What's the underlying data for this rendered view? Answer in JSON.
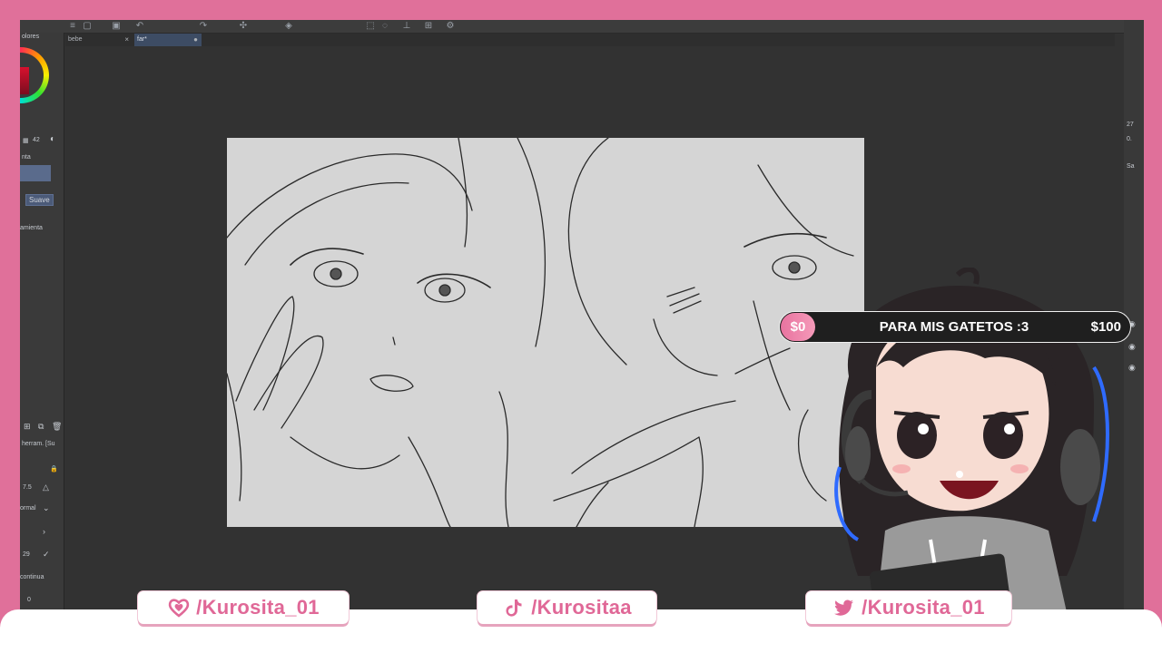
{
  "app": {
    "tabs": [
      {
        "label": "bebe",
        "close": "×"
      },
      {
        "label": "far*",
        "close": "●"
      }
    ],
    "left_panel": {
      "color_header": "olores",
      "size_value": "42",
      "tool_header": "nta",
      "soft_button": "Suave",
      "tool_label": "amienta",
      "layer_label": "herram. [Su",
      "opacity_value": "7.5",
      "blend_mode": "ormal",
      "value_29": "29",
      "continue_label": "continua",
      "zero_value": "0"
    },
    "right_panel": {
      "value_a": "27",
      "value_b": "0.",
      "label_sa": "Sa"
    }
  },
  "goal": {
    "start": "$0",
    "title": "PARA MIS GATETOS :3",
    "end": "$100",
    "progress": 0
  },
  "socials": [
    {
      "icon": "kofi-heart-icon",
      "text": "/Kurosita_01"
    },
    {
      "icon": "tiktok-icon",
      "text": "/Kurositaa"
    },
    {
      "icon": "twitter-bird-icon",
      "text": "/Kurosita_01"
    }
  ],
  "colors": {
    "frame_pink": "#e0709a",
    "accent_pink": "#e06897",
    "app_bg": "#323232",
    "canvas": "#d5d5d5"
  }
}
